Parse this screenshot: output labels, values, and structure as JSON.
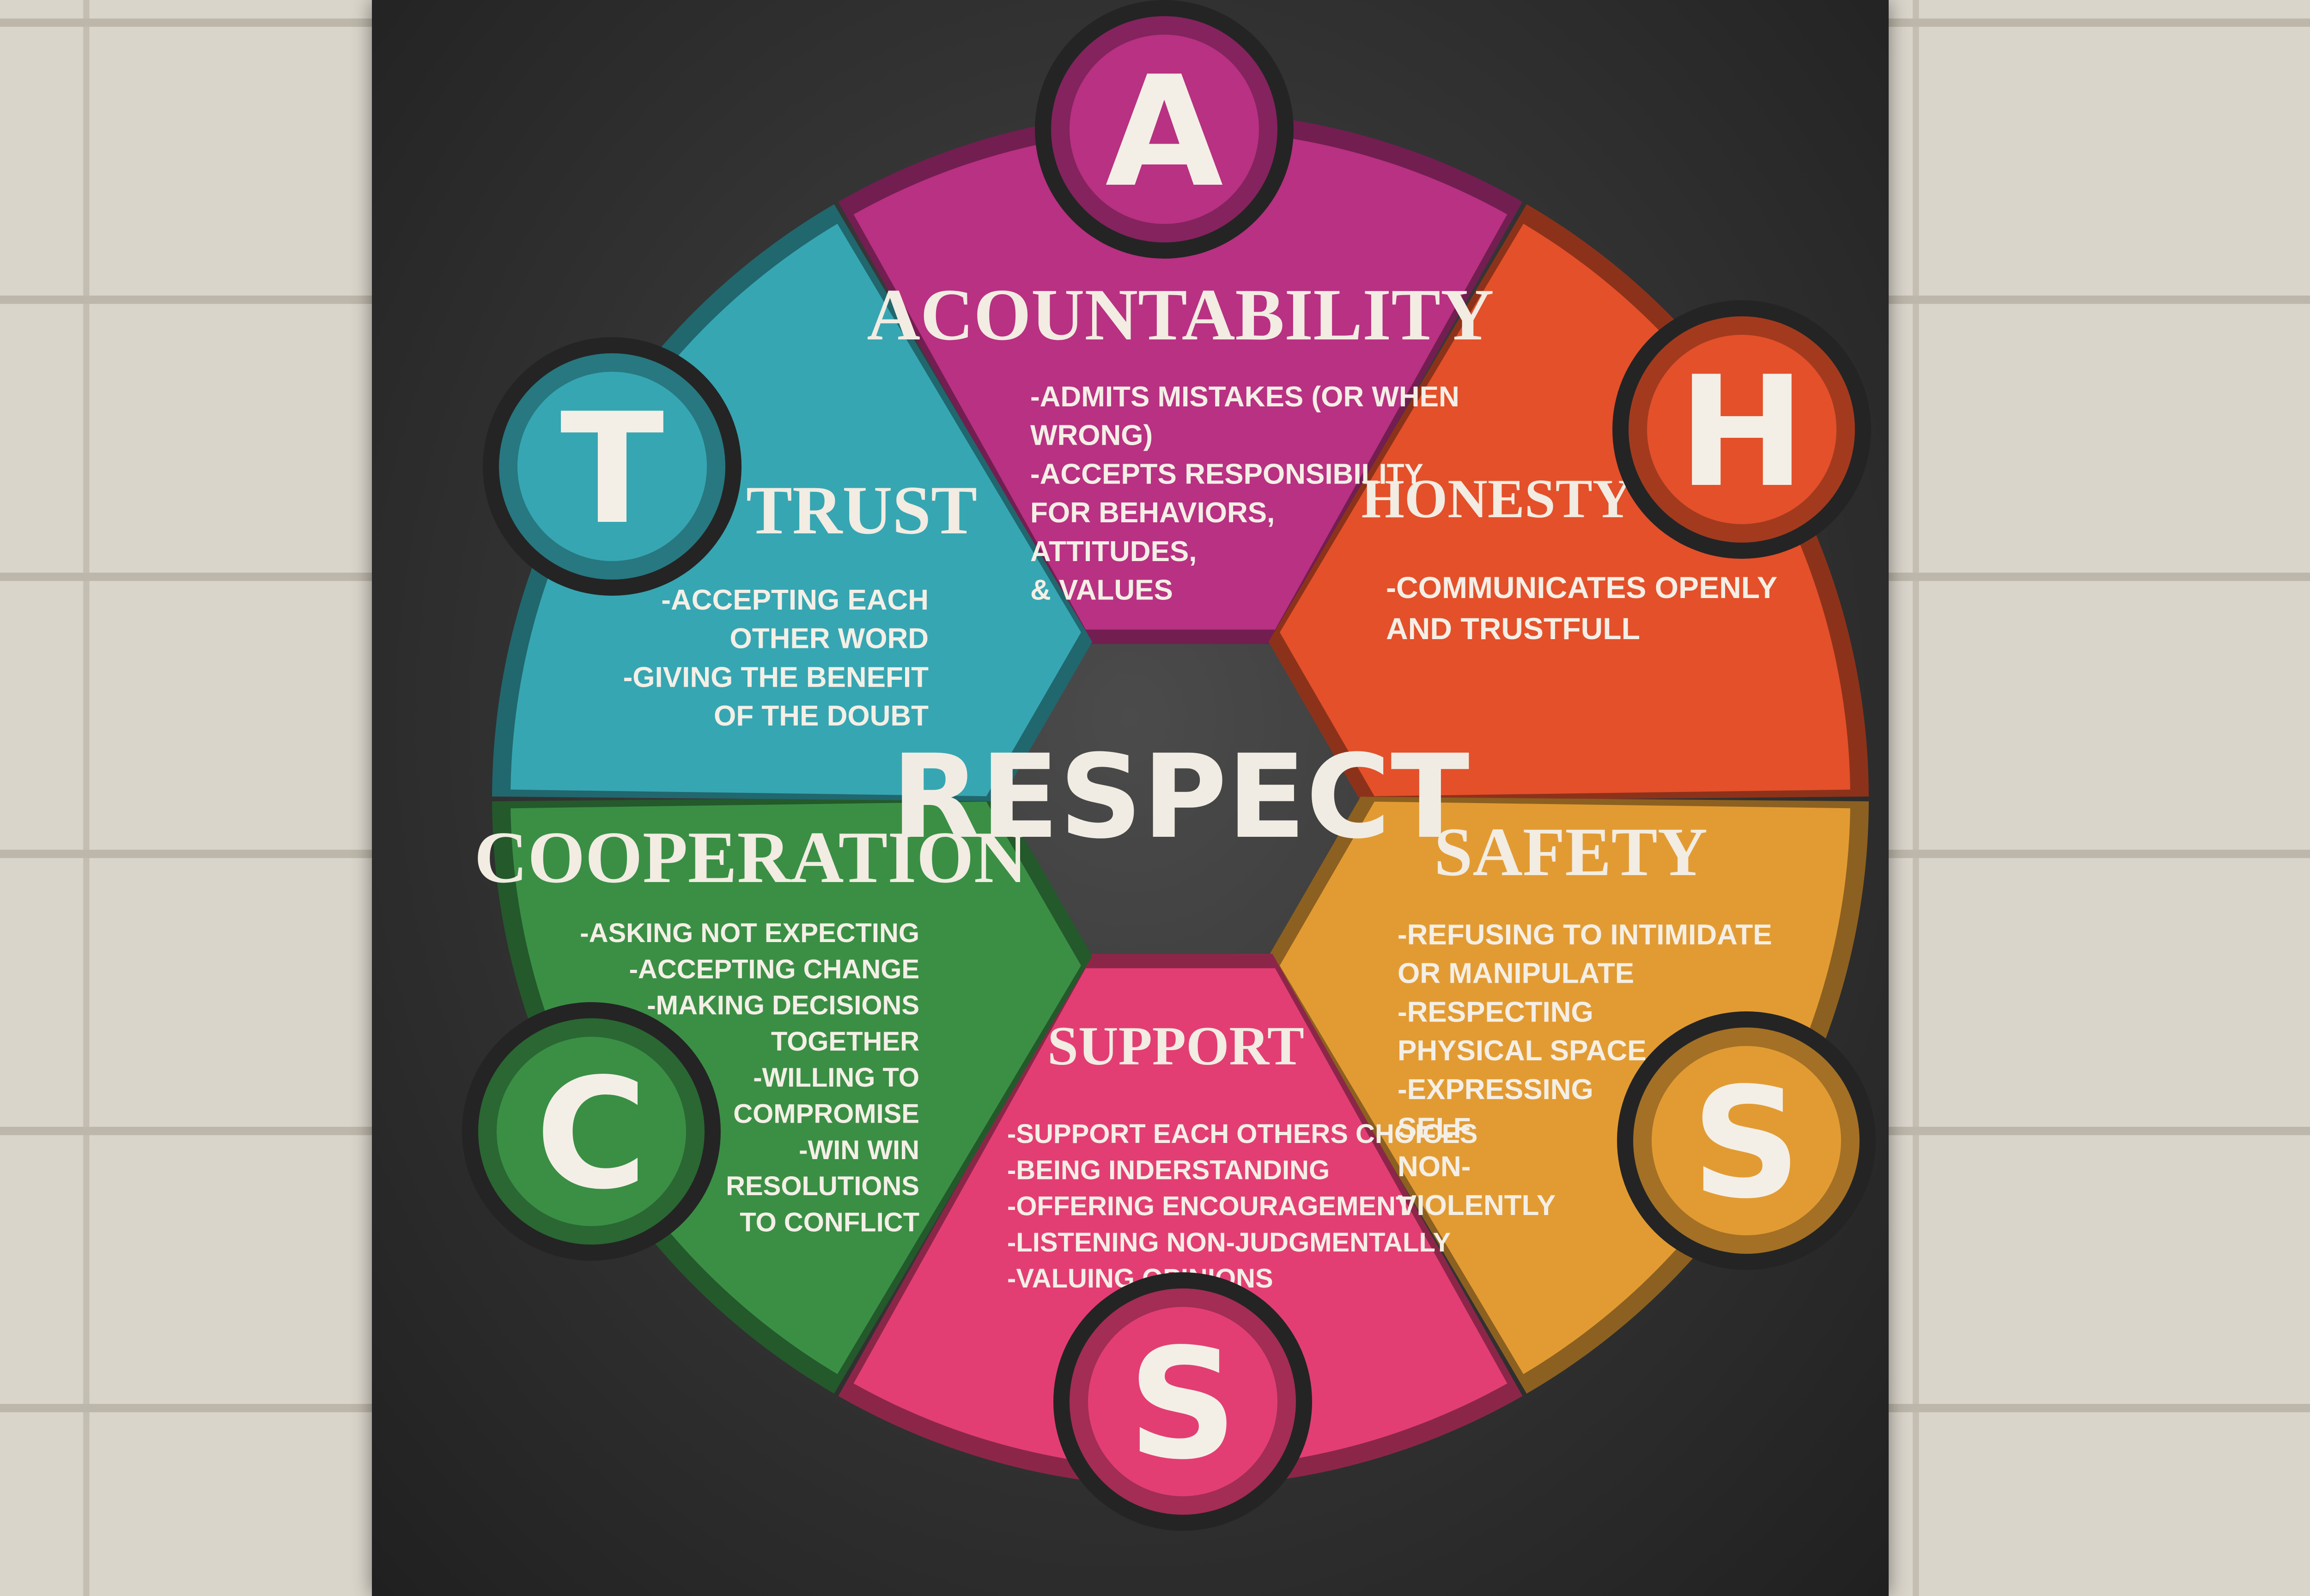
{
  "center": "RESPECT",
  "sectors": [
    {
      "key": "accountability",
      "letter": "A",
      "title": "ACOUNTABILITY",
      "color": "#b83182",
      "lines": [
        "-ADMITS MISTAKES (OR WHEN",
        "WRONG)",
        "-ACCEPTS RESPONSIBILITY",
        "FOR BEHAVIORS,",
        "ATTITUDES,",
        "& VALUES"
      ]
    },
    {
      "key": "honesty",
      "letter": "H",
      "title": "HONESTY",
      "color": "#e3502a",
      "lines": [
        "-COMMUNICATES OPENLY",
        "AND TRUSTFULL"
      ]
    },
    {
      "key": "safety",
      "letter": "S",
      "title": "SAFETY",
      "color": "#e29b33",
      "lines": [
        "-REFUSING TO INTIMIDATE",
        "OR MANIPULATE",
        "-RESPECTING",
        "PHYSICAL SPACE",
        "-EXPRESSING",
        "SELF",
        "NON-",
        "VIOLENTLY"
      ]
    },
    {
      "key": "support",
      "letter": "S",
      "title": "SUPPORT",
      "color": "#e23e74",
      "lines": [
        "-SUPPORT EACH OTHERS CHOICES",
        "-BEING INDERSTANDING",
        "-OFFERING ENCOURAGEMENT",
        "-LISTENING NON-JUDGMENTALLY",
        "-VALUING          OPINIONS"
      ]
    },
    {
      "key": "cooperation",
      "letter": "C",
      "title": "COOPERATION",
      "color": "#3a8f45",
      "lines": [
        "-ASKING NOT EXPECTING",
        "-ACCEPTING CHANGE",
        "-MAKING DECISIONS",
        "TOGETHER",
        "-WILLING TO",
        "COMPROMISE",
        "-WIN WIN",
        "RESOLUTIONS",
        "TO CONFLICT"
      ]
    },
    {
      "key": "trust",
      "letter": "T",
      "title": "TRUST",
      "color": "#36a6b2",
      "lines": [
        "-ACCEPTING EACH",
        "OTHER WORD",
        "-GIVING THE BENEFIT",
        "OF THE DOUBT"
      ]
    }
  ]
}
